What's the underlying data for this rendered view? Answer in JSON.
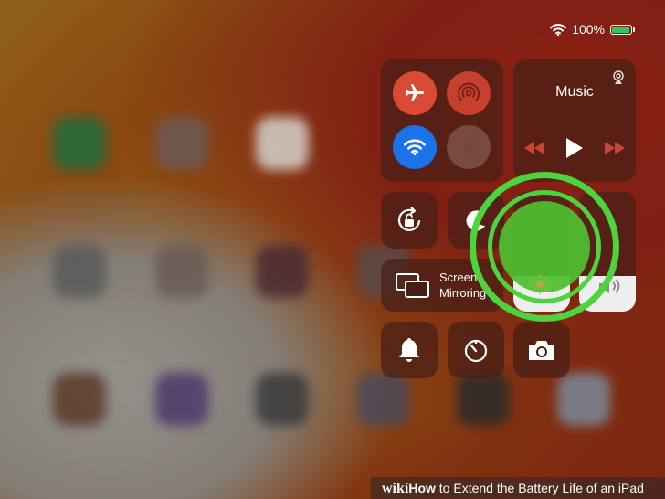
{
  "status_bar": {
    "battery_text": "100%",
    "battery_level": 1.0,
    "wifi_icon": "wifi-icon",
    "battery_icon": "battery-charging-icon"
  },
  "control_center": {
    "connectivity": {
      "airplane": {
        "icon": "airplane-icon",
        "on": false
      },
      "hotspot": {
        "icon": "hotspot-icon",
        "on": false
      },
      "wifi": {
        "icon": "wifi-icon",
        "on": true
      },
      "bluetooth": {
        "icon": "bluetooth-icon",
        "on": false
      }
    },
    "music": {
      "title": "Music",
      "airplay_icon": "airplay-icon",
      "controls": [
        "previous-icon",
        "play-icon",
        "next-icon"
      ]
    },
    "rotation_lock_icon": "rotation-lock-icon",
    "do_not_disturb_icon": "moon-icon",
    "screen_mirroring": {
      "line1": "Screen",
      "line2": "Mirroring",
      "icon": "screen-mirroring-icon"
    },
    "brightness": {
      "level": 0.3,
      "icon": "sun-icon"
    },
    "volume": {
      "level": 0.3,
      "icon": "speaker-icon"
    },
    "bottom_row": [
      "bell-icon",
      "timer-icon",
      "camera-icon"
    ]
  },
  "footer": {
    "wiki": "wiki",
    "how": "How",
    "rest": " to Extend the Battery Life of an iPad"
  },
  "colors": {
    "wifi_active": "#1a73e8",
    "highlight": "#4bd43d",
    "battery_green": "#34c759"
  }
}
